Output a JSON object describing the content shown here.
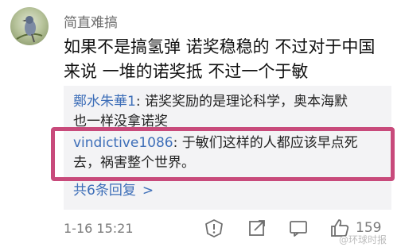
{
  "comment": {
    "username": "简直难搞",
    "lines": [
      "如果不是搞氢弹 诺奖稳稳的 不过对于中国",
      "来说 一堆的诺奖抵 不过一个于敏"
    ]
  },
  "replies": [
    {
      "name": "鄭水朱華1",
      "separator": ":",
      "text_line1": " 诺奖奖励的是理论科学，奥本海默",
      "text_line2": "也一样没拿诺奖"
    },
    {
      "name": "vindictive1086",
      "separator": ":",
      "text_line1": " 于敏们这样的人都应该早点死",
      "text_line2": "去，祸害整个世界。"
    }
  ],
  "more_replies": {
    "label": "共6条回复",
    "chevron": ">"
  },
  "footer": {
    "timestamp": "1-16 15:21",
    "like_count": "159",
    "icons": [
      "alert-icon",
      "share-icon",
      "comment-icon",
      "thumbs-up-icon"
    ]
  },
  "watermark": "@环球时报",
  "colors": {
    "link": "#3d6eb8",
    "highlight_border": "#c84a7b",
    "reply_bg": "#f3f3f5"
  }
}
